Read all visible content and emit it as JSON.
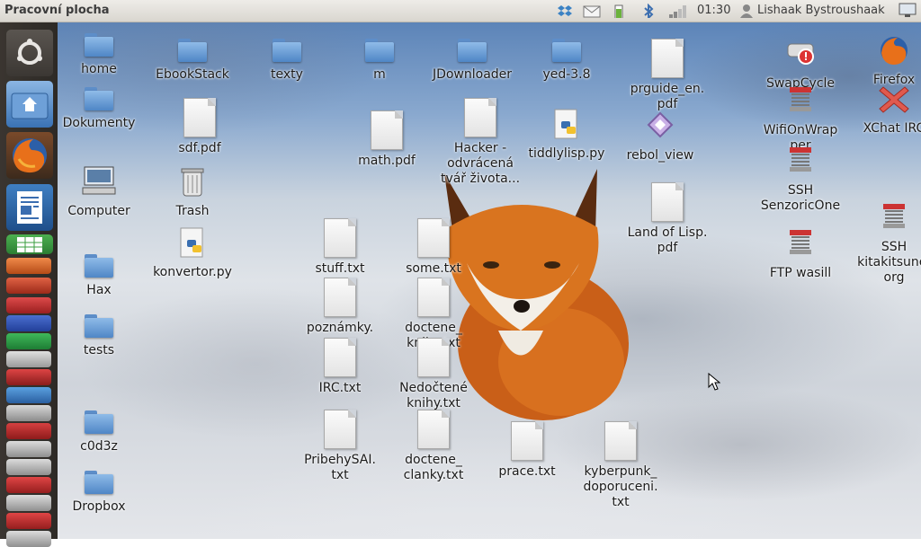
{
  "panel": {
    "title": "Pracovní plocha",
    "clock": "01:30",
    "user": "Lishaak Bystroushaak",
    "indicators": [
      "dropbox-icon",
      "mail-icon",
      "battery-icon",
      "bluetooth-icon",
      "signal-icon",
      "user-icon",
      "display-icon"
    ]
  },
  "launcher": {
    "items": [
      "ubuntu-logo-icon",
      "home-folder-icon",
      "firefox-icon",
      "writer-icon",
      "calc-icon",
      "app-stack"
    ]
  },
  "desktop": {
    "icons": [
      {
        "label": "home",
        "type": "folder-home"
      },
      {
        "label": "Dokumenty",
        "type": "folder"
      },
      {
        "label": "Computer",
        "type": "computer"
      },
      {
        "label": "Hax",
        "type": "folder"
      },
      {
        "label": "tests",
        "type": "folder"
      },
      {
        "label": "c0d3z",
        "type": "folder"
      },
      {
        "label": "Dropbox",
        "type": "folder"
      },
      {
        "label": "EbookStack",
        "type": "folder"
      },
      {
        "label": "sdf.pdf",
        "type": "doc"
      },
      {
        "label": "Trash",
        "type": "trash"
      },
      {
        "label": "konvertor.py",
        "type": "python"
      },
      {
        "label": "texty",
        "type": "folder"
      },
      {
        "label": "stuff.txt",
        "type": "doc"
      },
      {
        "label": "poznámky.",
        "type": "doc"
      },
      {
        "label": "IRC.txt",
        "type": "doc"
      },
      {
        "label": "PribehySAI.\ntxt",
        "type": "doc"
      },
      {
        "label": "m",
        "type": "folder"
      },
      {
        "label": "math.pdf",
        "type": "doc"
      },
      {
        "label": "some.txt",
        "type": "doc"
      },
      {
        "label": "doctene_\nknihy.txt",
        "type": "doc"
      },
      {
        "label": "Nedočtené\nknihy.txt",
        "type": "doc"
      },
      {
        "label": "doctene_\nclanky.txt",
        "type": "doc"
      },
      {
        "label": "JDownloader",
        "type": "folder"
      },
      {
        "label": "Hacker -\nodvrácená\ntvář života...",
        "type": "doc"
      },
      {
        "label": "yed-3.8",
        "type": "folder"
      },
      {
        "label": "tiddlylisp.py",
        "type": "python"
      },
      {
        "label": "prace.txt",
        "type": "doc"
      },
      {
        "label": "prguide_en.\npdf",
        "type": "doc"
      },
      {
        "label": "rebol_view",
        "type": "rebol"
      },
      {
        "label": "Land of Lisp.\npdf",
        "type": "doc"
      },
      {
        "label": "kyberpunk_\ndoporuceni.\ntxt",
        "type": "doc"
      },
      {
        "label": "SwapCycle",
        "type": "swap"
      },
      {
        "label": "WifiOnWrap\nper",
        "type": "spring"
      },
      {
        "label": "SSH\nSenzoricOne",
        "type": "spring"
      },
      {
        "label": "FTP wasill",
        "type": "spring"
      },
      {
        "label": "Firefox",
        "type": "firefox"
      },
      {
        "label": "XChat IRC",
        "type": "xchat"
      },
      {
        "label": "SSH\nkitakitsune.\norg",
        "type": "spring"
      }
    ]
  },
  "colors": {
    "panel_bg": "#dcd9d2",
    "launcher_bg": "#332f2b",
    "folder": "#5f91cc",
    "firefox": "#e86a17"
  }
}
